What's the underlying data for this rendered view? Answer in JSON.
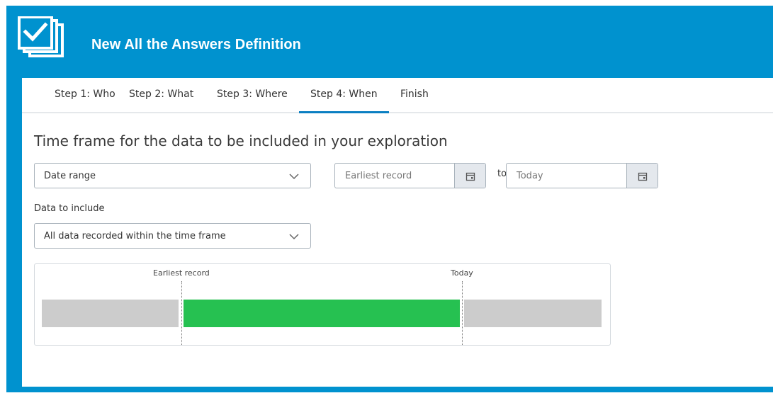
{
  "header": {
    "title": "New All the Answers Definition",
    "logo_icon": "checklist-stack-icon"
  },
  "tabs": [
    {
      "label": "Step 1: Who",
      "active": false
    },
    {
      "label": "Step 2: What",
      "active": false
    },
    {
      "label": "Step 3: Where",
      "active": false
    },
    {
      "label": "Step 4: When",
      "active": true
    },
    {
      "label": "Finish",
      "active": false
    }
  ],
  "main": {
    "section_title": "Time frame for the data to be included in your exploration",
    "range_select": {
      "value": "Date range"
    },
    "start_date": {
      "placeholder": "Earliest record",
      "icon": "calendar-icon"
    },
    "to_label": "to",
    "end_date": {
      "placeholder": "Today",
      "icon": "calendar-icon"
    },
    "data_label": "Data to include",
    "data_select": {
      "value": "All data recorded within the time frame"
    }
  },
  "timeline": {
    "start_label": "Earliest record",
    "end_label": "Today"
  },
  "colors": {
    "brand_blue": "#0092cf",
    "tab_active": "#0a7fc2",
    "included_green": "#26c151",
    "excluded_gray": "#cccccc"
  }
}
